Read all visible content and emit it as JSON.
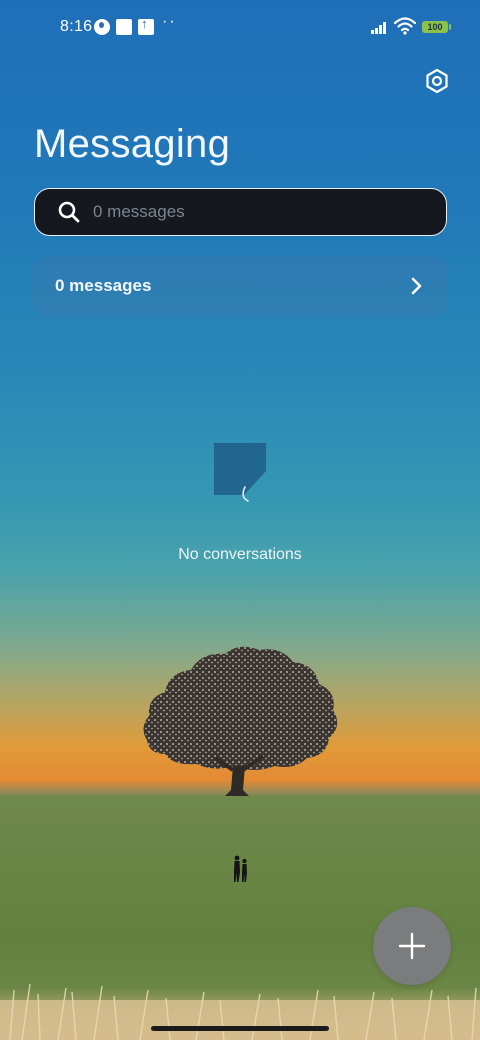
{
  "status_bar": {
    "time": "8:16",
    "battery": "100",
    "icons": [
      "app-notification-icon",
      "square-notification-icon",
      "upload-notification-icon",
      "more-dots-icon",
      "signal-icon",
      "wifi-icon",
      "battery-icon"
    ]
  },
  "header": {
    "title": "Messaging",
    "settings_icon": "settings-hexagon-icon"
  },
  "search": {
    "placeholder": "0 messages",
    "value": ""
  },
  "messages_row": {
    "label": "0 messages",
    "icon": "chevron-right-icon"
  },
  "empty_state": {
    "icon": "empty-chat-bubble-icon",
    "text": "No conversations"
  },
  "fab": {
    "icon": "plus-icon"
  },
  "colors": {
    "search_bg": "#15191f",
    "fab_bg": "#7a7c7e",
    "sky_top": "#1f6fb8",
    "horizon": "#e29a37",
    "field": "#6a8646"
  }
}
